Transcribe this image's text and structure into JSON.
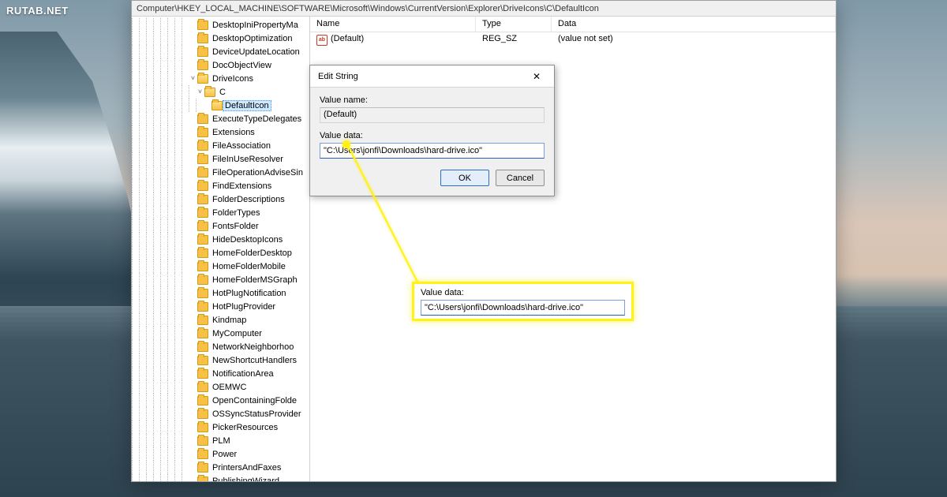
{
  "watermark": "RUTAB.NET",
  "address": "Computer\\HKEY_LOCAL_MACHINE\\SOFTWARE\\Microsoft\\Windows\\CurrentVersion\\Explorer\\DriveIcons\\C\\DefaultIcon",
  "tree": [
    {
      "d": 8,
      "e": "",
      "l": "DesktopIniPropertyMa"
    },
    {
      "d": 8,
      "e": "",
      "l": "DesktopOptimization"
    },
    {
      "d": 8,
      "e": "",
      "l": "DeviceUpdateLocation"
    },
    {
      "d": 8,
      "e": "",
      "l": "DocObjectView"
    },
    {
      "d": 8,
      "e": "v",
      "l": "DriveIcons",
      "open": true
    },
    {
      "d": 9,
      "e": "v",
      "l": "C",
      "open": true
    },
    {
      "d": 10,
      "e": "",
      "l": "DefaultIcon",
      "sel": true,
      "open": true
    },
    {
      "d": 8,
      "e": "",
      "l": "ExecuteTypeDelegates"
    },
    {
      "d": 8,
      "e": "",
      "l": "Extensions"
    },
    {
      "d": 8,
      "e": "",
      "l": "FileAssociation"
    },
    {
      "d": 8,
      "e": "",
      "l": "FileInUseResolver"
    },
    {
      "d": 8,
      "e": "",
      "l": "FileOperationAdviseSin"
    },
    {
      "d": 8,
      "e": "",
      "l": "FindExtensions"
    },
    {
      "d": 8,
      "e": "",
      "l": "FolderDescriptions"
    },
    {
      "d": 8,
      "e": "",
      "l": "FolderTypes"
    },
    {
      "d": 8,
      "e": "",
      "l": "FontsFolder"
    },
    {
      "d": 8,
      "e": "",
      "l": "HideDesktopIcons"
    },
    {
      "d": 8,
      "e": "",
      "l": "HomeFolderDesktop"
    },
    {
      "d": 8,
      "e": "",
      "l": "HomeFolderMobile"
    },
    {
      "d": 8,
      "e": "",
      "l": "HomeFolderMSGraph"
    },
    {
      "d": 8,
      "e": "",
      "l": "HotPlugNotification"
    },
    {
      "d": 8,
      "e": "",
      "l": "HotPlugProvider"
    },
    {
      "d": 8,
      "e": "",
      "l": "Kindmap"
    },
    {
      "d": 8,
      "e": "",
      "l": "MyComputer"
    },
    {
      "d": 8,
      "e": "",
      "l": "NetworkNeighborhoo"
    },
    {
      "d": 8,
      "e": "",
      "l": "NewShortcutHandlers"
    },
    {
      "d": 8,
      "e": "",
      "l": "NotificationArea"
    },
    {
      "d": 8,
      "e": "",
      "l": "OEMWC"
    },
    {
      "d": 8,
      "e": "",
      "l": "OpenContainingFolde"
    },
    {
      "d": 8,
      "e": "",
      "l": "OSSyncStatusProvider"
    },
    {
      "d": 8,
      "e": "",
      "l": "PickerResources"
    },
    {
      "d": 8,
      "e": "",
      "l": "PLM"
    },
    {
      "d": 8,
      "e": "",
      "l": "Power"
    },
    {
      "d": 8,
      "e": "",
      "l": "PrintersAndFaxes"
    },
    {
      "d": 8,
      "e": "",
      "l": "PublishingWizard"
    }
  ],
  "cols": {
    "name": "Name",
    "type": "Type",
    "data": "Data"
  },
  "row": {
    "name": "(Default)",
    "type": "REG_SZ",
    "data": "(value not set)",
    "ico": "ab"
  },
  "dialog": {
    "title": "Edit String",
    "name_lbl": "Value name:",
    "name": "(Default)",
    "data_lbl": "Value data:",
    "data": "\"C:\\Users\\jonfi\\Downloads\\hard-drive.ico\"",
    "ok": "OK",
    "cancel": "Cancel"
  },
  "callout": {
    "lbl": "Value data:",
    "val": "\"C:\\Users\\jonfi\\Downloads\\hard-drive.ico\""
  }
}
